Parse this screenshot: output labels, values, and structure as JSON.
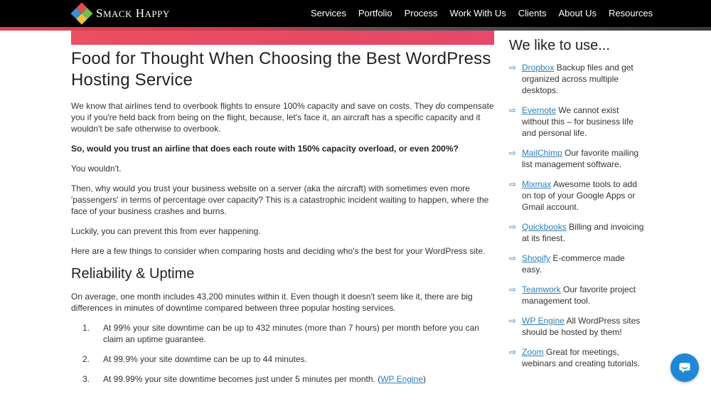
{
  "header": {
    "logo_text": "Smack Happy",
    "nav": [
      "Services",
      "Portfolio",
      "Process",
      "Work With Us",
      "Clients",
      "About Us",
      "Resources"
    ]
  },
  "article": {
    "title": "Food for Thought When Choosing the Best WordPress Hosting Service",
    "p1_a": "We know that airlines tend to overbook flights to ensure 100% capacity and save on costs. They ",
    "p1_em": "do",
    "p1_b": " compensate you if you're held back from being on the flight, because, let's face it, an aircraft has a specific capacity and it wouldn't be safe otherwise to overbook.",
    "p2": "So, would you trust an airline that does each route with 150% capacity overload, or even 200%?",
    "p3": "You wouldn't.",
    "p4": "Then, why would you trust your business website on a server (aka the aircraft) with sometimes even more 'passengers' in terms of percentage over capacity? This is a catastrophic incident waiting to happen, where the face of your business crashes and burns.",
    "p5": "Luckily, you can prevent this from ever happening.",
    "p6": "Here are a few things to consider when comparing hosts and deciding who's the best for your WordPress site.",
    "h2": "Reliability & Uptime",
    "p7": "On average, one month includes 43,200 minutes within it. Even though it doesn't seem like it, there are big differences in minutes of downtime compared between three popular hosting services.",
    "list": [
      {
        "num": "1.",
        "text": "At 99% your site downtime can be up to 432 minutes (more than 7 hours) per month before you can claim an uptime guarantee."
      },
      {
        "num": "2.",
        "text": "At 99.9% your site downtime can be up to 44 minutes."
      },
      {
        "num": "3.",
        "text": "At 99.99% your site downtime becomes just under 5 minutes per month. (",
        "link": "WP Engine",
        "after": ")"
      }
    ]
  },
  "sidebar": {
    "title": "We like to use...",
    "arrow": "⇨",
    "tools": [
      {
        "name": "Dropbox",
        "desc": " Backup files and get organized across multiple desktops."
      },
      {
        "name": "Evernote",
        "desc": " We cannot exist without this – for business life and personal life."
      },
      {
        "name": "MailChimp",
        "desc": " Our favorite mailing list management software."
      },
      {
        "name": "Mixmax",
        "desc": " Awesome tools to add on top of your Google Apps or Gmail account."
      },
      {
        "name": "Quickbooks",
        "desc": " Billing and invoicing at its finest."
      },
      {
        "name": "Shopify",
        "desc": " E-commerce made easy."
      },
      {
        "name": "Teamwork",
        "desc": " Our favorite project management tool."
      },
      {
        "name": "WP Engine",
        "desc": " All WordPress sites should be hosted by them!"
      },
      {
        "name": "Zoom",
        "desc": " Great for meetings, webinars and creating tutorials."
      }
    ]
  },
  "colors": {
    "accent": "#e64a62",
    "link": "#2d7fbf",
    "chat": "#1e88d6"
  }
}
